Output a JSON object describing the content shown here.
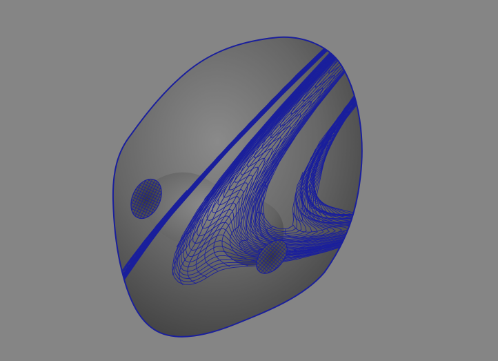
{
  "viewport": {
    "background_color": "#858585",
    "model": {
      "subject": "nose",
      "display_mode": "wireframe-on-shaded",
      "surface_color": "#666666",
      "highlight_color": "#8a8a8a",
      "shadow_color": "#3c3c3c",
      "wireframe_color": "#1a1f9c",
      "nostril_color": "#4a4a4a"
    }
  }
}
